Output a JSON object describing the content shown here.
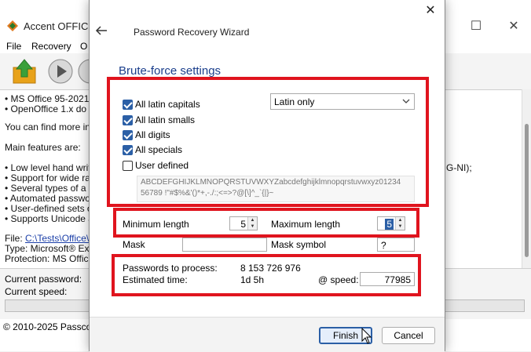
{
  "background_app": {
    "title": "Accent OFFICE",
    "menu": [
      "File",
      "Recovery",
      "O"
    ],
    "text_lines": [
      "• MS Office 95-2021",
      "• OpenOffice 1.x do",
      "You can find more inf",
      "Main features are:",
      "• Low level hand writ",
      "• Support for wide ra",
      "• Several types of a",
      "• Automated passwo",
      "• User-defined sets o",
      "• Supports Unicode a"
    ],
    "text_right_fragment": "G-NI);",
    "file_line_label": "File:",
    "file_line_path": "C:\\Tests\\Office\\E",
    "type_line": "Type: Microsoft® Exc",
    "protection_line": "Protection: MS Office",
    "current_password_label": "Current password:",
    "current_speed_label": "Current speed:",
    "copyright": "© 2010-2025 Passco"
  },
  "dialog": {
    "title": "Password Recovery Wizard",
    "heading": "Brute-force settings",
    "checkboxes": [
      {
        "label": "All latin capitals",
        "checked": true
      },
      {
        "label": "All latin smalls",
        "checked": true
      },
      {
        "label": "All digits",
        "checked": true
      },
      {
        "label": "All specials",
        "checked": true
      },
      {
        "label": "User defined",
        "checked": false
      }
    ],
    "charset_select": "Latin only",
    "charset_line1": "ABCDEFGHIJKLMNOPQRSTUVWXYZabcdefghijklmnopqrstuvwxyz01234",
    "charset_line2": "56789 !\"#$%&'()*+,-./:;<=>?@[\\]^_`{|}~ ",
    "min_length_label": "Minimum length",
    "min_length_value": "5",
    "max_length_label": "Maximum length",
    "max_length_value": "5",
    "mask_label": "Mask",
    "mask_value": "",
    "mask_symbol_label": "Mask symbol",
    "mask_symbol_value": "?",
    "passwords_label": "Passwords to process:",
    "passwords_value": "8 153 726 976",
    "estimated_label": "Estimated time:",
    "estimated_value": "1d 5h",
    "speed_label": "@ speed:",
    "speed_value": "77985",
    "finish_button": "Finish",
    "cancel_button": "Cancel"
  },
  "colors": {
    "highlight_box": "#e0141e",
    "heading": "#1a3e8c",
    "accent": "#2b5fa6"
  }
}
